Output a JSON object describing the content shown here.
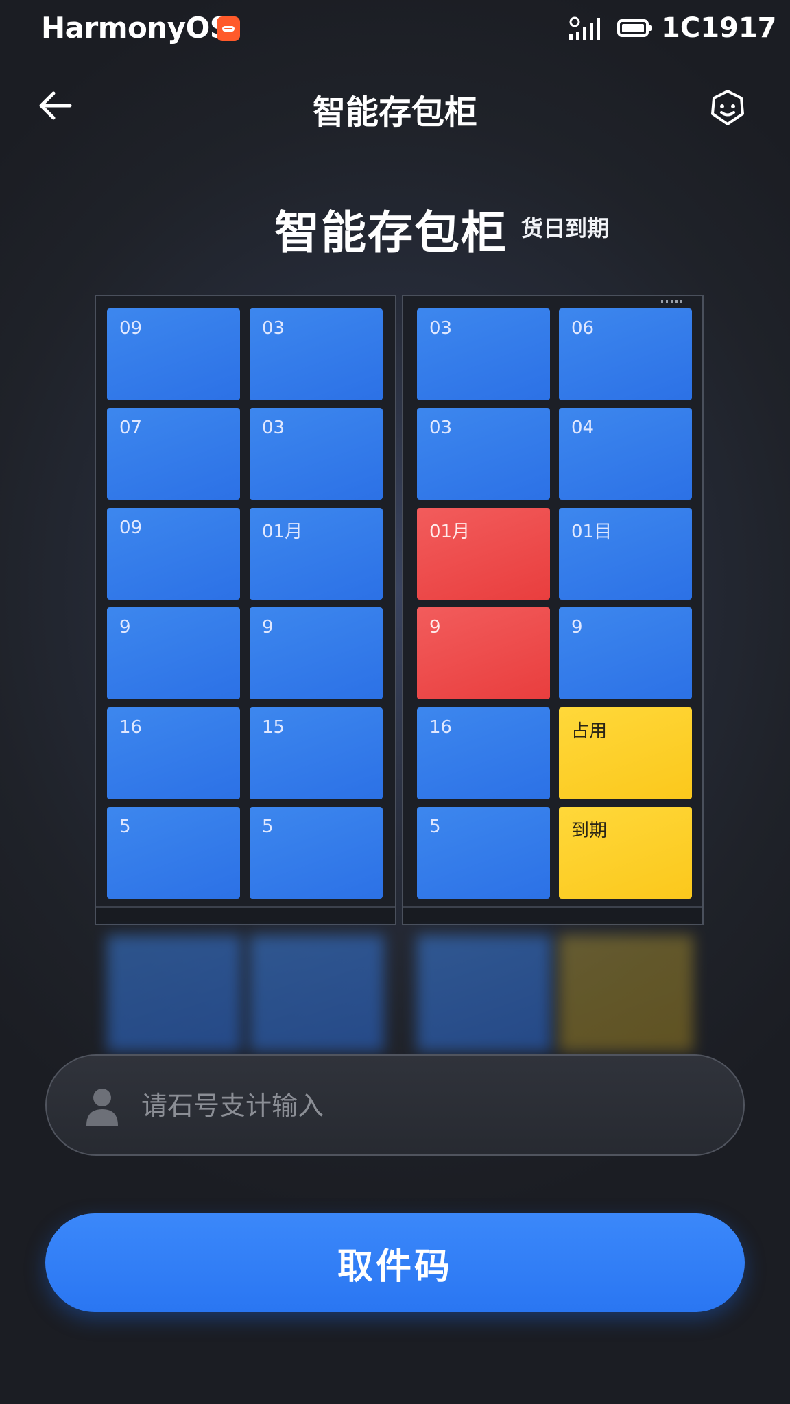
{
  "status_bar": {
    "brand": "HarmonyOS",
    "time": "1C1917"
  },
  "nav": {
    "title": "智能存包柜"
  },
  "hero": {
    "title": "智能存包柜",
    "subtitle": "货日到期"
  },
  "cabinets": {
    "left": [
      {
        "label": "09",
        "status": "blue"
      },
      {
        "label": "03",
        "status": "blue"
      },
      {
        "label": "07",
        "status": "blue"
      },
      {
        "label": "03",
        "status": "blue"
      },
      {
        "label": "09",
        "status": "blue"
      },
      {
        "label": "01月",
        "status": "blue"
      },
      {
        "label": "9",
        "status": "blue"
      },
      {
        "label": "9",
        "status": "blue"
      },
      {
        "label": "16",
        "status": "blue"
      },
      {
        "label": "15",
        "status": "blue"
      },
      {
        "label": "5",
        "status": "blue"
      },
      {
        "label": "5",
        "status": "blue"
      }
    ],
    "right": [
      {
        "label": "03",
        "status": "blue"
      },
      {
        "label": "06",
        "status": "blue"
      },
      {
        "label": "03",
        "status": "blue"
      },
      {
        "label": "04",
        "status": "blue"
      },
      {
        "label": "01月",
        "status": "red"
      },
      {
        "label": "01目",
        "status": "blue"
      },
      {
        "label": "9",
        "status": "red"
      },
      {
        "label": "9",
        "status": "blue"
      },
      {
        "label": "16",
        "status": "blue"
      },
      {
        "label": "占用",
        "status": "yellow"
      },
      {
        "label": "5",
        "status": "blue"
      },
      {
        "label": "到期",
        "status": "yellow"
      }
    ]
  },
  "colors": {
    "blue": "#3479ea",
    "red": "#ee4a4a",
    "yellow": "#fdd02a",
    "button": "#2f7ef5"
  },
  "input": {
    "placeholder": "请石号支计输入",
    "value": ""
  },
  "button": {
    "label": "取件码"
  }
}
